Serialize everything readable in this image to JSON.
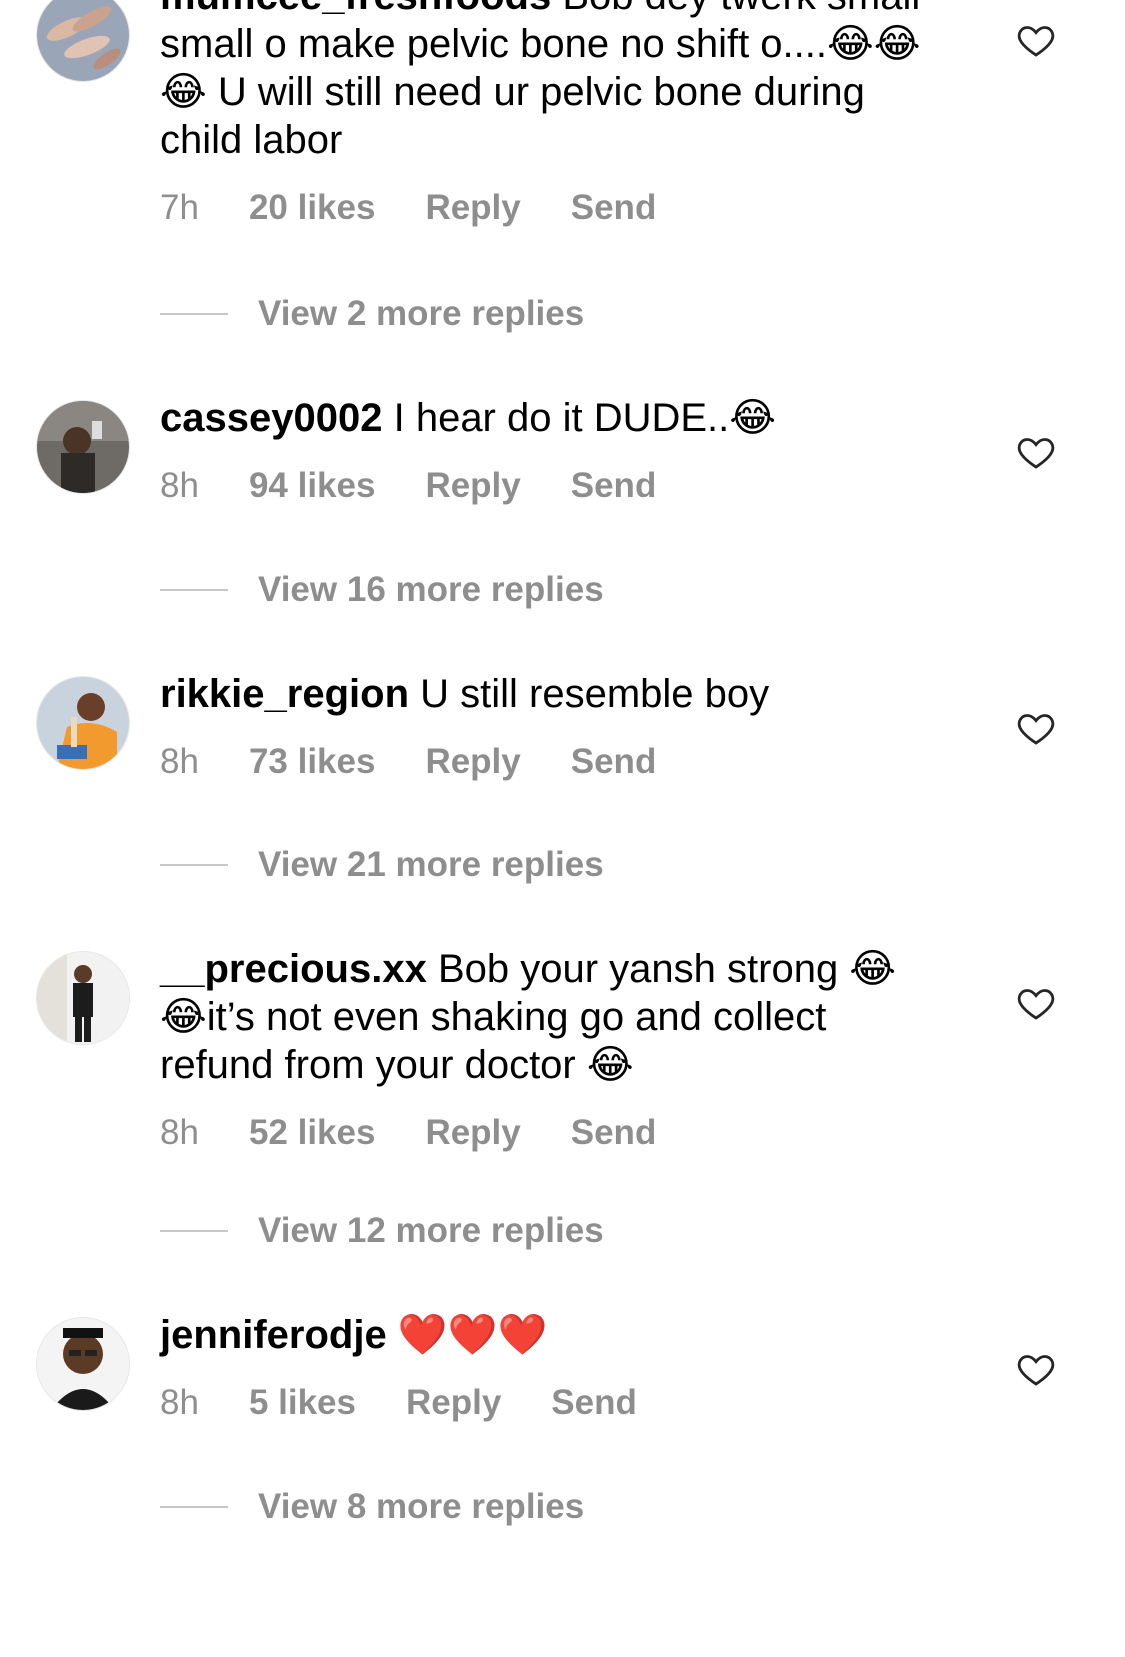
{
  "comments": [
    {
      "username": "mumcee_freshfoods",
      "text": "Bob dey twerk small small o make pelvic bone no shift o....😂😂😂 U will still need ur pelvic bone during child labor",
      "time": "7h",
      "likes": "20 likes",
      "reply": "Reply",
      "send": "Send",
      "view_replies": "View 2 more replies",
      "avatar_desc": "shrimp-photo-avatar"
    },
    {
      "username": "cassey0002",
      "text": "I hear do it DUDE..😂",
      "time": "8h",
      "likes": "94 likes",
      "reply": "Reply",
      "send": "Send",
      "view_replies": "View 16 more replies",
      "avatar_desc": "selfie-avatar"
    },
    {
      "username": "rikkie_region",
      "text": "U still resemble boy",
      "time": "8h",
      "likes": "73 likes",
      "reply": "Reply",
      "send": "Send",
      "view_replies": "View 21 more replies",
      "avatar_desc": "woman-orange-avatar"
    },
    {
      "username": "__precious.xx",
      "text": "Bob your yansh strong 😂😂it’s not even shaking go and collect refund from your doctor 😂",
      "time": "8h",
      "likes": "52 likes",
      "reply": "Reply",
      "send": "Send",
      "view_replies": "View 12 more replies",
      "avatar_desc": "man-standing-avatar"
    },
    {
      "username": "jenniferodje",
      "text": "❤️❤️❤️",
      "time": "8h",
      "likes": "5 likes",
      "reply": "Reply",
      "send": "Send",
      "view_replies": "View 8 more replies",
      "avatar_desc": "man-glasses-avatar"
    }
  ]
}
